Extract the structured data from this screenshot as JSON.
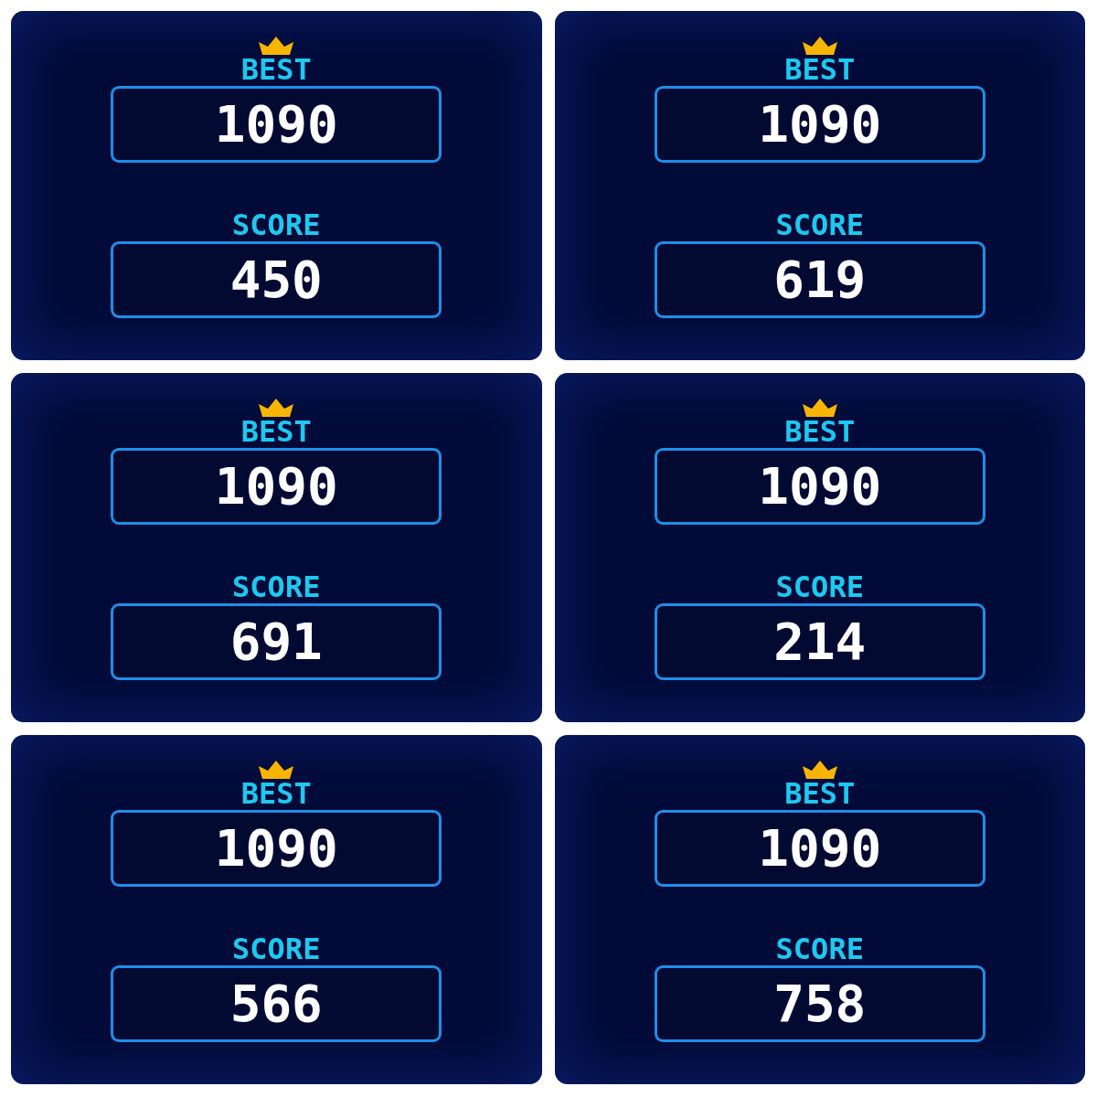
{
  "panels": [
    {
      "best": {
        "label": "BEST",
        "value": "1090"
      },
      "score": {
        "label": "SCORE",
        "value": "450"
      }
    },
    {
      "best": {
        "label": "BEST",
        "value": "1090"
      },
      "score": {
        "label": "SCORE",
        "value": "619"
      }
    },
    {
      "best": {
        "label": "BEST",
        "value": "1090"
      },
      "score": {
        "label": "SCORE",
        "value": "691"
      }
    },
    {
      "best": {
        "label": "BEST",
        "value": "1090"
      },
      "score": {
        "label": "SCORE",
        "value": "214"
      }
    },
    {
      "best": {
        "label": "BEST",
        "value": "1090"
      },
      "score": {
        "label": "SCORE",
        "value": "566"
      }
    },
    {
      "best": {
        "label": "BEST",
        "value": "1090"
      },
      "score": {
        "label": "SCORE",
        "value": "758"
      }
    }
  ]
}
